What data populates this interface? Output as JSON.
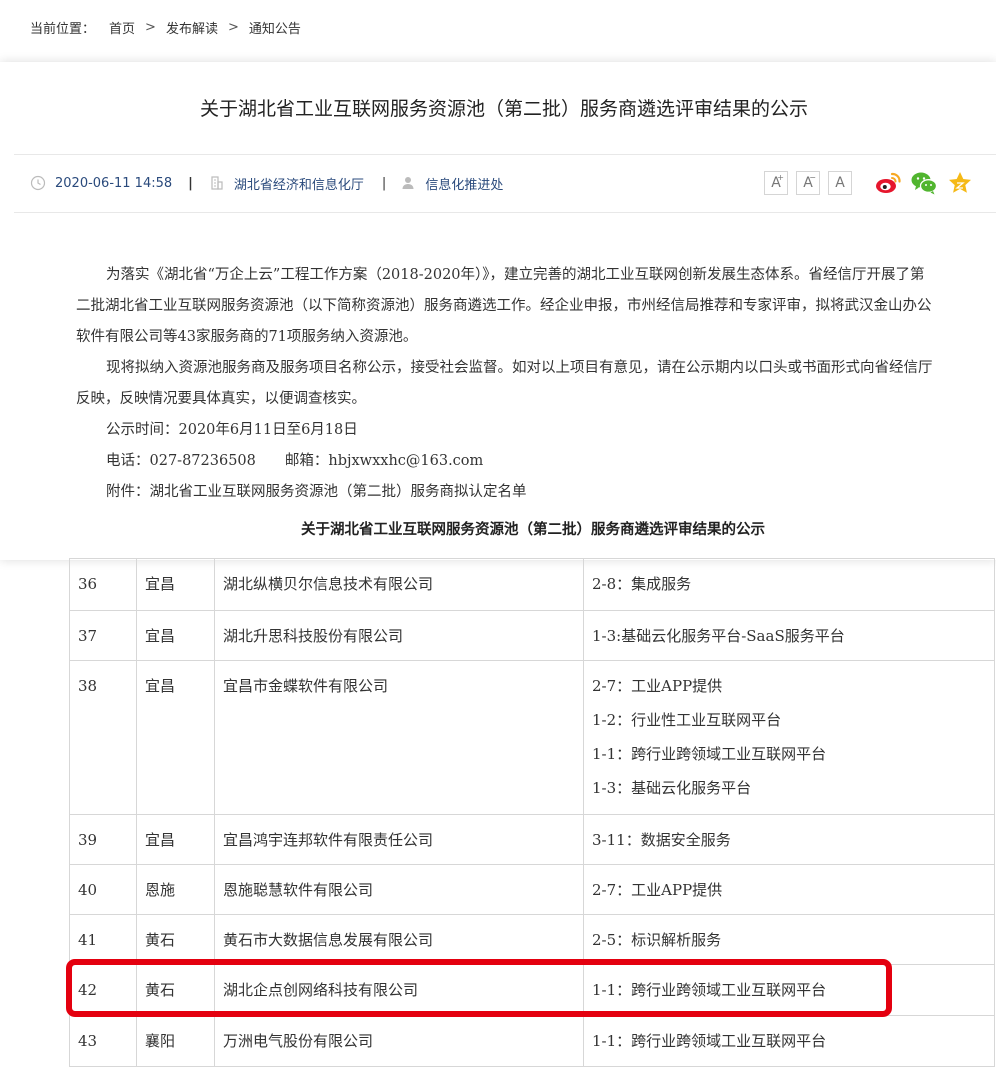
{
  "breadcrumb": {
    "label": "当前位置：",
    "items": [
      "首页",
      "发布解读",
      "通知公告"
    ],
    "separator": ">"
  },
  "article": {
    "title": "关于湖北省工业互联网服务资源池（第二批）服务商遴选评审结果的公示",
    "meta": {
      "datetime": "2020-06-11 14:58",
      "publisher": "湖北省经济和信息化厅",
      "department": "信息化推进处"
    },
    "font_buttons": [
      "A",
      "A",
      "A"
    ],
    "share_icons": [
      "weibo-icon",
      "wechat-icon",
      "favorite-star-icon"
    ],
    "paragraphs": [
      "为落实《湖北省“万企上云”工程工作方案（2018-2020年）》，建立完善的湖北工业互联网创新发展生态体系。省经信厅开展了第二批湖北省工业互联网服务资源池（以下简称资源池）服务商遴选工作。经企业申报，市州经信局推荐和专家评审，拟将武汉金山办公软件有限公司等43家服务商的71项服务纳入资源池。",
      "现将拟纳入资源池服务商及服务项目名称公示，接受社会监督。如对以上项目有意见，请在公示期内以口头或书面形式向省经信厅反映，反映情况要具体真实，以便调查核实。",
      "公示时间：2020年6月11日至6月18日",
      "电话：027-87236508　　邮箱：hbjxwxxhc@163.com",
      "附件：湖北省工业互联网服务资源池（第二批）服务商拟认定名单"
    ],
    "subtitle": "关于湖北省工业互联网服务资源池（第二批）服务商遴选评审结果的公示"
  },
  "table": {
    "rows": [
      {
        "no": "36",
        "city": "宜昌",
        "company": "湖北纵横贝尔信息技术有限公司",
        "services": [
          "2-8：集成服务"
        ]
      },
      {
        "no": "37",
        "city": "宜昌",
        "company": "湖北升思科技股份有限公司",
        "services": [
          "1-3:基础云化服务平台-SaaS服务平台"
        ]
      },
      {
        "no": "38",
        "city": "宜昌",
        "company": "宜昌市金蝶软件有限公司",
        "services": [
          "2-7：工业APP提供",
          "1-2：行业性工业互联网平台",
          "1-1：跨行业跨领域工业互联网平台",
          "1-3：基础云化服务平台"
        ]
      },
      {
        "no": "39",
        "city": "宜昌",
        "company": "宜昌鸿宇连邦软件有限责任公司",
        "services": [
          "3-11：数据安全服务"
        ]
      },
      {
        "no": "40",
        "city": "恩施",
        "company": "恩施聪慧软件有限公司",
        "services": [
          "2-7：工业APP提供"
        ]
      },
      {
        "no": "41",
        "city": "黄石",
        "company": "黄石市大数据信息发展有限公司",
        "services": [
          "2-5：标识解析服务"
        ]
      },
      {
        "no": "42",
        "city": "黄石",
        "company": "湖北企点创网络科技有限公司",
        "services": [
          "1-1：跨行业跨领域工业互联网平台"
        ]
      },
      {
        "no": "43",
        "city": "襄阳",
        "company": "万洲电气股份有限公司",
        "services": [
          "1-1：跨行业跨领域工业互联网平台"
        ]
      }
    ],
    "highlighted_row": "42",
    "highlight_color": "#e4000f"
  }
}
